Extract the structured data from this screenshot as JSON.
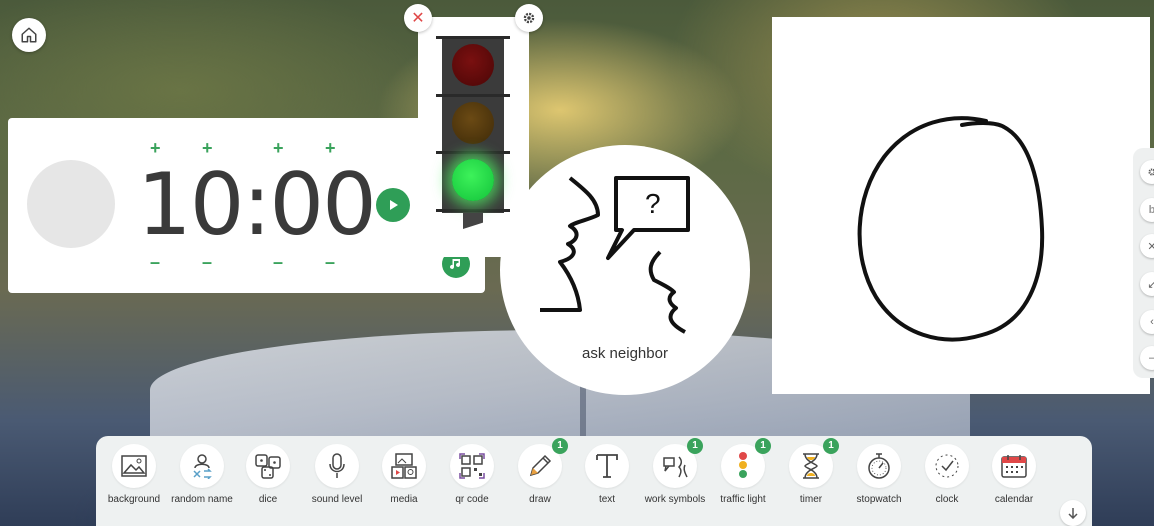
{
  "timer": {
    "time": "10:00",
    "plus": "+",
    "minus": "–"
  },
  "traffic_light": {
    "close": "✕",
    "active_light": "green"
  },
  "ask_neighbor": {
    "label": "ask neighbor",
    "question_mark": "?"
  },
  "toolbar": {
    "items": [
      {
        "label": "background",
        "icon": "image-icon"
      },
      {
        "label": "random name",
        "icon": "random-name-icon"
      },
      {
        "label": "dice",
        "icon": "dice-icon"
      },
      {
        "label": "sound level",
        "icon": "microphone-icon"
      },
      {
        "label": "media",
        "icon": "media-icon"
      },
      {
        "label": "qr code",
        "icon": "qr-code-icon"
      },
      {
        "label": "draw",
        "icon": "pencil-icon",
        "badge": "1"
      },
      {
        "label": "text",
        "icon": "text-icon"
      },
      {
        "label": "work symbols",
        "icon": "work-symbols-icon",
        "badge": "1"
      },
      {
        "label": "traffic light",
        "icon": "traffic-light-icon",
        "badge": "1"
      },
      {
        "label": "timer",
        "icon": "hourglass-icon",
        "badge": "1"
      },
      {
        "label": "stopwatch",
        "icon": "stopwatch-icon"
      },
      {
        "label": "clock",
        "icon": "clock-icon"
      },
      {
        "label": "calendar",
        "icon": "calendar-icon"
      }
    ]
  },
  "colors": {
    "accent_green": "#3aa35c",
    "close_red": "#e04848"
  }
}
